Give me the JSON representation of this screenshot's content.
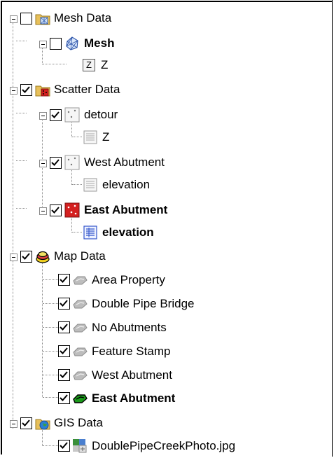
{
  "tree": {
    "mesh_data": {
      "label": "Mesh Data",
      "checked": false,
      "icon": "folder-mesh-icon"
    },
    "mesh": {
      "label": "Mesh",
      "checked": false,
      "icon": "mesh-icon"
    },
    "mesh_z": {
      "label": "Z",
      "icon": "z-dataset-icon"
    },
    "scatter_data": {
      "label": "Scatter Data",
      "checked": true,
      "icon": "folder-scatter-icon"
    },
    "detour": {
      "label": "detour",
      "checked": true,
      "icon": "scatter-set-icon"
    },
    "detour_z": {
      "label": "Z",
      "icon": "dataset-icon"
    },
    "west_abutment": {
      "label": "West Abutment",
      "checked": true,
      "icon": "scatter-set-icon"
    },
    "west_elevation": {
      "label": "elevation",
      "icon": "dataset-icon"
    },
    "east_abutment": {
      "label": "East Abutment",
      "checked": true,
      "icon": "scatter-set-active-icon"
    },
    "east_elevation": {
      "label": "elevation",
      "icon": "dataset-active-icon"
    },
    "map_data": {
      "label": "Map Data",
      "checked": true,
      "icon": "folder-map-icon"
    },
    "area_property": {
      "label": "Area Property",
      "checked": true,
      "icon": "coverage-icon"
    },
    "double_pipe_bridge": {
      "label": "Double Pipe Bridge",
      "checked": true,
      "icon": "coverage-icon"
    },
    "no_abutments": {
      "label": "No Abutments",
      "checked": true,
      "icon": "coverage-icon"
    },
    "feature_stamp": {
      "label": "Feature Stamp",
      "checked": true,
      "icon": "coverage-icon"
    },
    "map_west_abutment": {
      "label": "West Abutment",
      "checked": true,
      "icon": "coverage-icon"
    },
    "map_east_abutment": {
      "label": "East Abutment",
      "checked": true,
      "icon": "coverage-active-icon"
    },
    "gis_data": {
      "label": "GIS Data",
      "checked": true,
      "icon": "folder-gis-icon"
    },
    "photo": {
      "label": "DoublePipeCreekPhoto.jpg",
      "checked": true,
      "icon": "image-file-icon"
    }
  },
  "colors": {
    "guide": "#8a8a8a",
    "coverage_inactive": "#8c8c8c",
    "coverage_active": "#1a9a1a",
    "scatter_active": "#d42020",
    "dataset_active": "#3355cc"
  }
}
